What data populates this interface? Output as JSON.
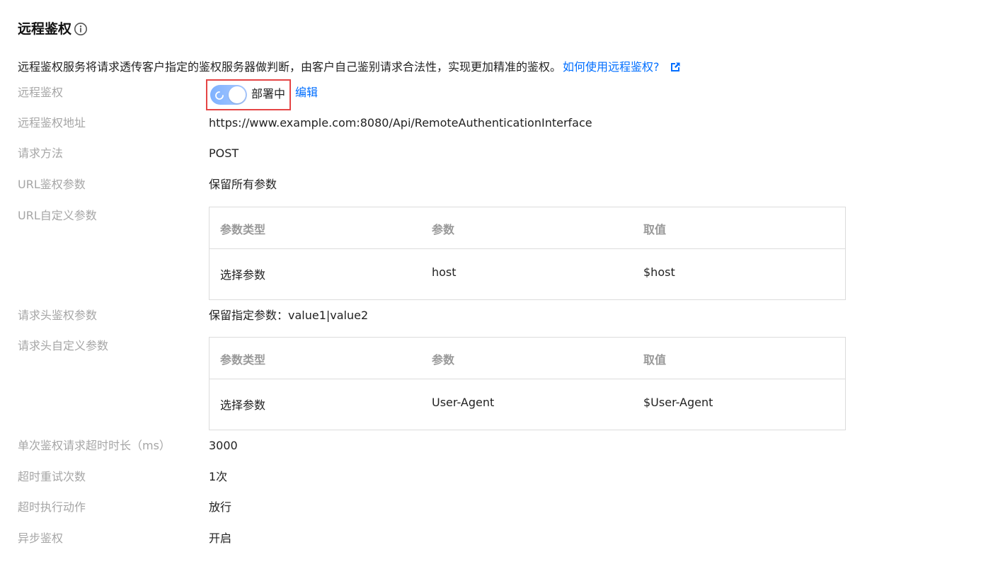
{
  "section": {
    "title": "远程鉴权",
    "info_icon": "info-circle-icon"
  },
  "description": {
    "text": "远程鉴权服务将请求透传客户指定的鉴权服务器做判断，由客户自己鉴别请求合法性，实现更加精准的鉴权。",
    "link_text": "如何使用远程鉴权?",
    "link_icon": "external-link-icon"
  },
  "toggle_row": {
    "label": "远程鉴权",
    "status_text": "部署中",
    "edit_label": "编辑"
  },
  "fields": {
    "address": {
      "label": "远程鉴权地址",
      "value": "https://www.example.com:8080/Api/RemoteAuthenticationInterface"
    },
    "method": {
      "label": "请求方法",
      "value": "POST"
    },
    "url_params": {
      "label": "URL鉴权参数",
      "value": "保留所有参数"
    },
    "url_custom": {
      "label": "URL自定义参数"
    },
    "header_params": {
      "label": "请求头鉴权参数",
      "value": "保留指定参数：value1|value2"
    },
    "header_custom": {
      "label": "请求头自定义参数"
    },
    "timeout": {
      "label": "单次鉴权请求超时时长（ms）",
      "value": "3000"
    },
    "retries": {
      "label": "超时重试次数",
      "value": "1次"
    },
    "timeout_action": {
      "label": "超时执行动作",
      "value": "放行"
    },
    "async": {
      "label": "异步鉴权",
      "value": "开启"
    }
  },
  "url_table": {
    "headers": [
      "参数类型",
      "参数",
      "取值"
    ],
    "rows": [
      [
        "选择参数",
        "host",
        "$host"
      ]
    ]
  },
  "header_table": {
    "headers": [
      "参数类型",
      "参数",
      "取值"
    ],
    "rows": [
      [
        "选择参数",
        "User-Agent",
        "$User-Agent"
      ]
    ]
  },
  "colors": {
    "link": "#006eff",
    "label": "#a6a6a6",
    "highlight_border": "#e54545"
  }
}
